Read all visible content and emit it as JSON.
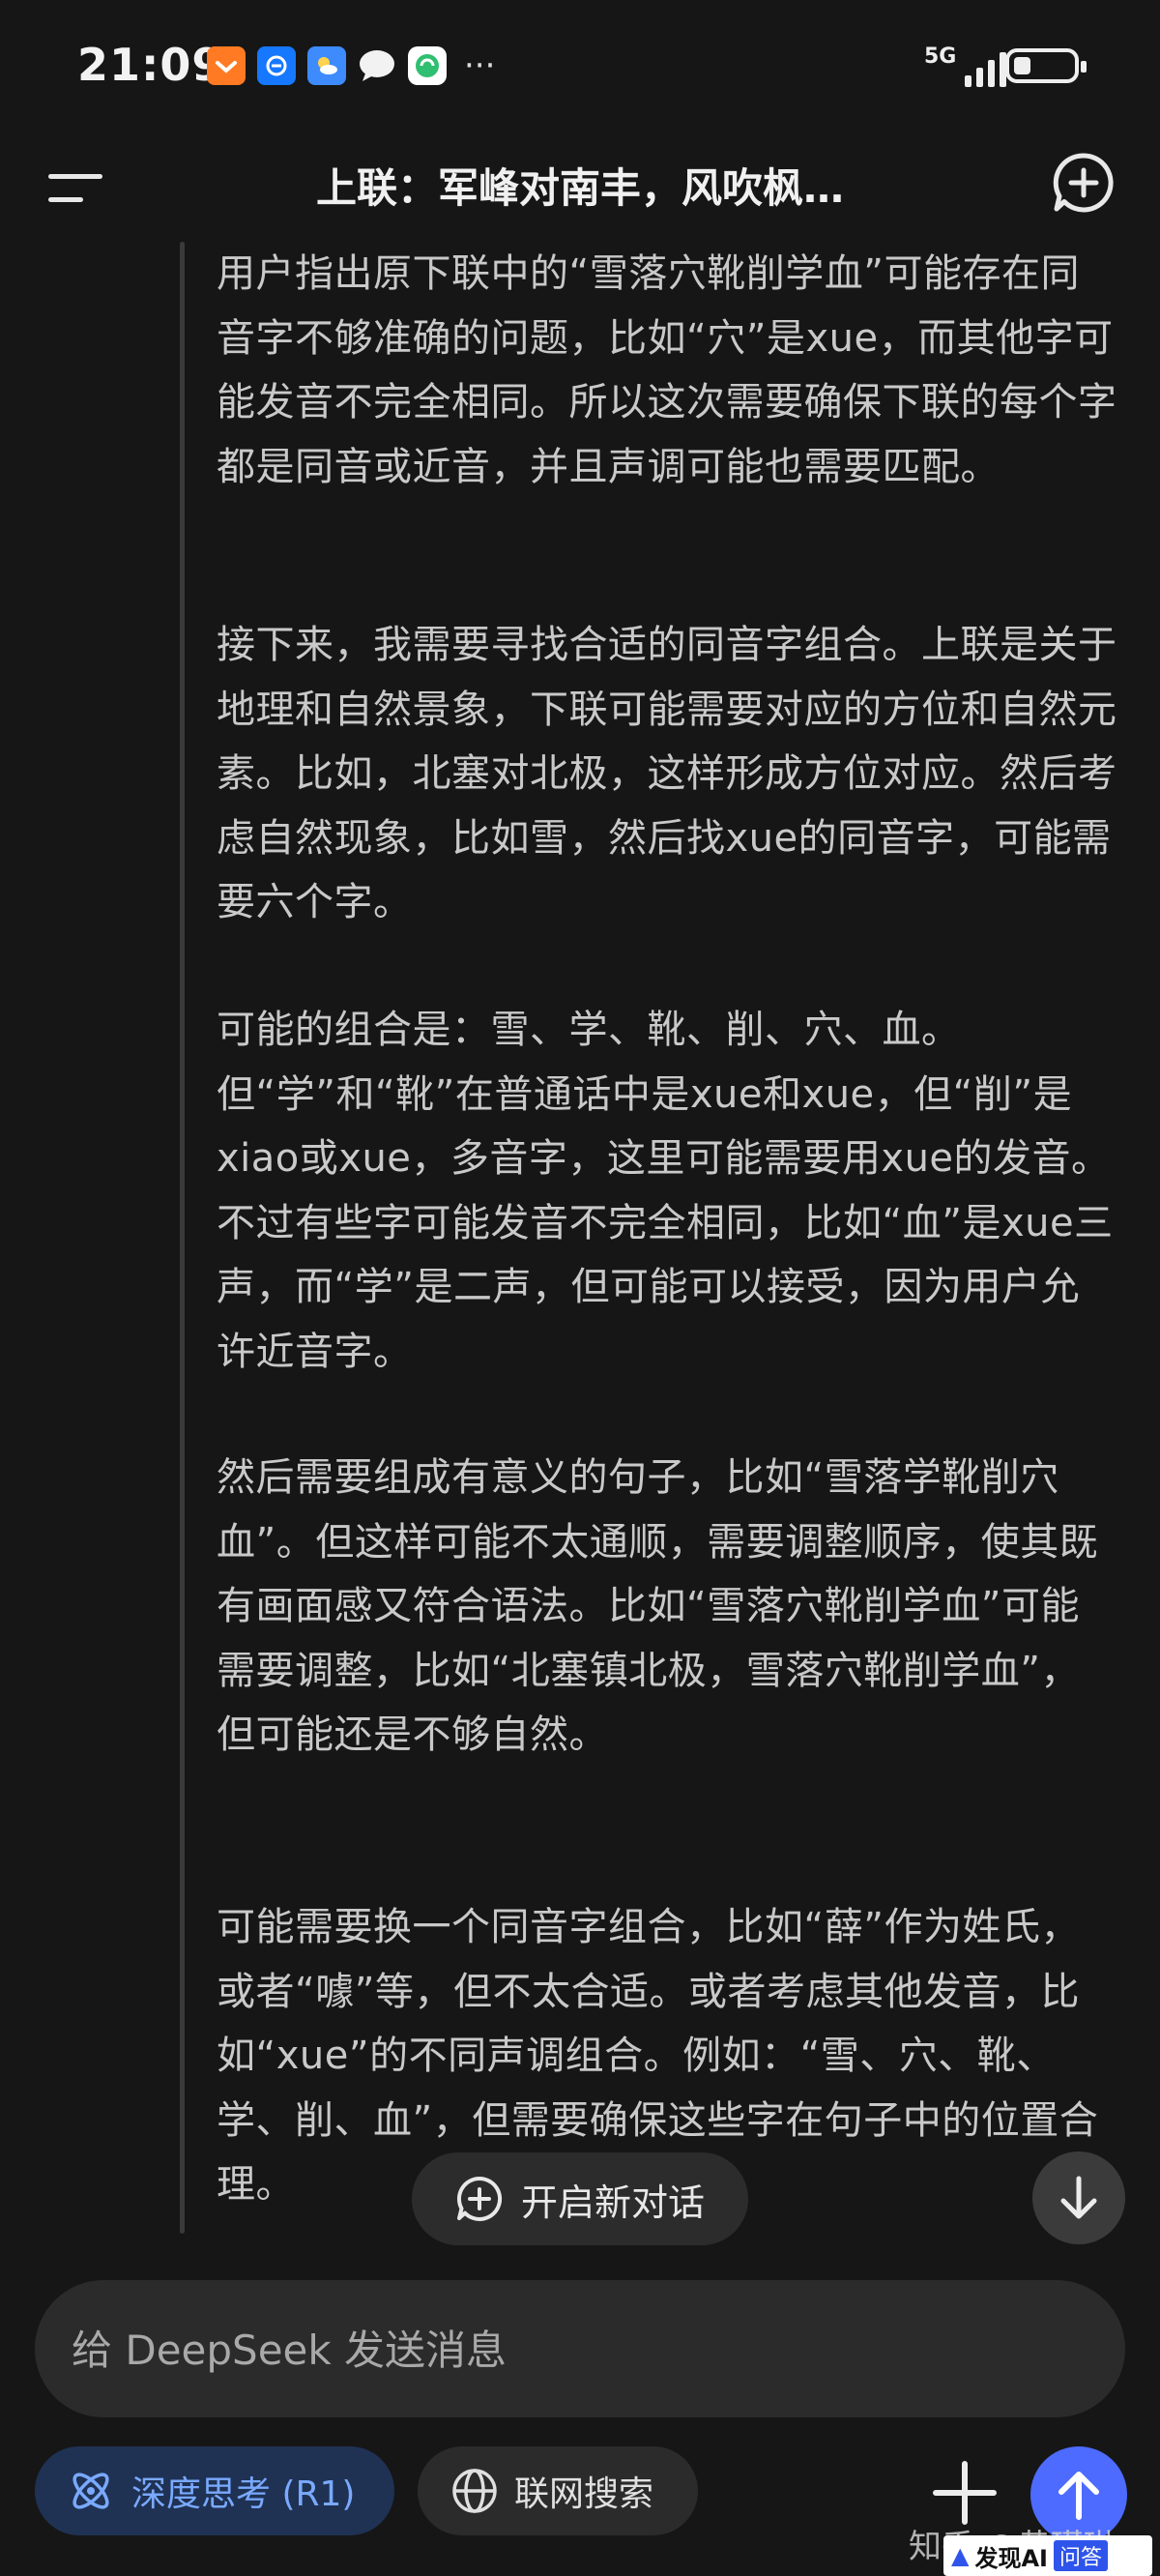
{
  "status_bar": {
    "time": "21:09",
    "network": "5G",
    "battery_level": 0.3,
    "icons": [
      "taobao-icon",
      "alipay-icon",
      "weather-icon",
      "chat-bubble-icon",
      "wechat-icon"
    ],
    "more": "···"
  },
  "header": {
    "title": "上联：军峰对南丰，风吹枫…"
  },
  "thinking": {
    "paragraphs": [
      "用户指出原下联中的“雪落穴靴削学血”可能存在同音字不够准确的问题，比如“穴”是xue，而其他字可能发音不完全相同。所以这次需要确保下联的每个字都是同音或近音，并且声调可能也需要匹配。",
      "接下来，我需要寻找合适的同音字组合。上联是关于地理和自然景象，下联可能需要对应的方位和自然元素。比如，北塞对北极，这样形成方位对应。然后考虑自然现象，比如雪，然后找xue的同音字，可能需要六个字。",
      "可能的组合是：雪、学、靴、削、穴、血。但“学”和“靴”在普通话中是xue和xue，但“削”是xiao或xue，多音字，这里可能需要用xue的发音。不过有些字可能发音不完全相同，比如“血”是xue三声，而“学”是二声，但可能可以接受，因为用户允许近音字。",
      "然后需要组成有意义的句子，比如“雪落学靴削穴血”。但这样可能不太通顺，需要调整顺序，使其既有画面感又符合语法。比如“雪落穴靴削学血”可能需要调整，比如“北塞镇北极，雪落穴靴削学血”，但可能还是不够自然。",
      "可能需要换一个同音字组合，比如“薛”作为姓氏，或者“噱”等，但不太合适。或者考虑其他发音，比如“xue”的不同声调组合。例如：“雪、穴、靴、学、削、血”，但需要确保这些字在句子中的位置合理。"
    ]
  },
  "floating": {
    "new_dialog_label": "开启新对话"
  },
  "composer": {
    "placeholder": "给 DeepSeek 发送消息",
    "deep_think_label": "深度思考 (R1)",
    "web_search_label": "联网搜索"
  },
  "watermark": {
    "zhihu": "知乎 @黄瑾琳",
    "brand": "发现AI",
    "tag": "问答"
  },
  "colors": {
    "background": "#161616",
    "accent": "#4d6bfe",
    "deep_think_text": "#7aa9ff",
    "deep_think_bg": "#1f3254"
  }
}
